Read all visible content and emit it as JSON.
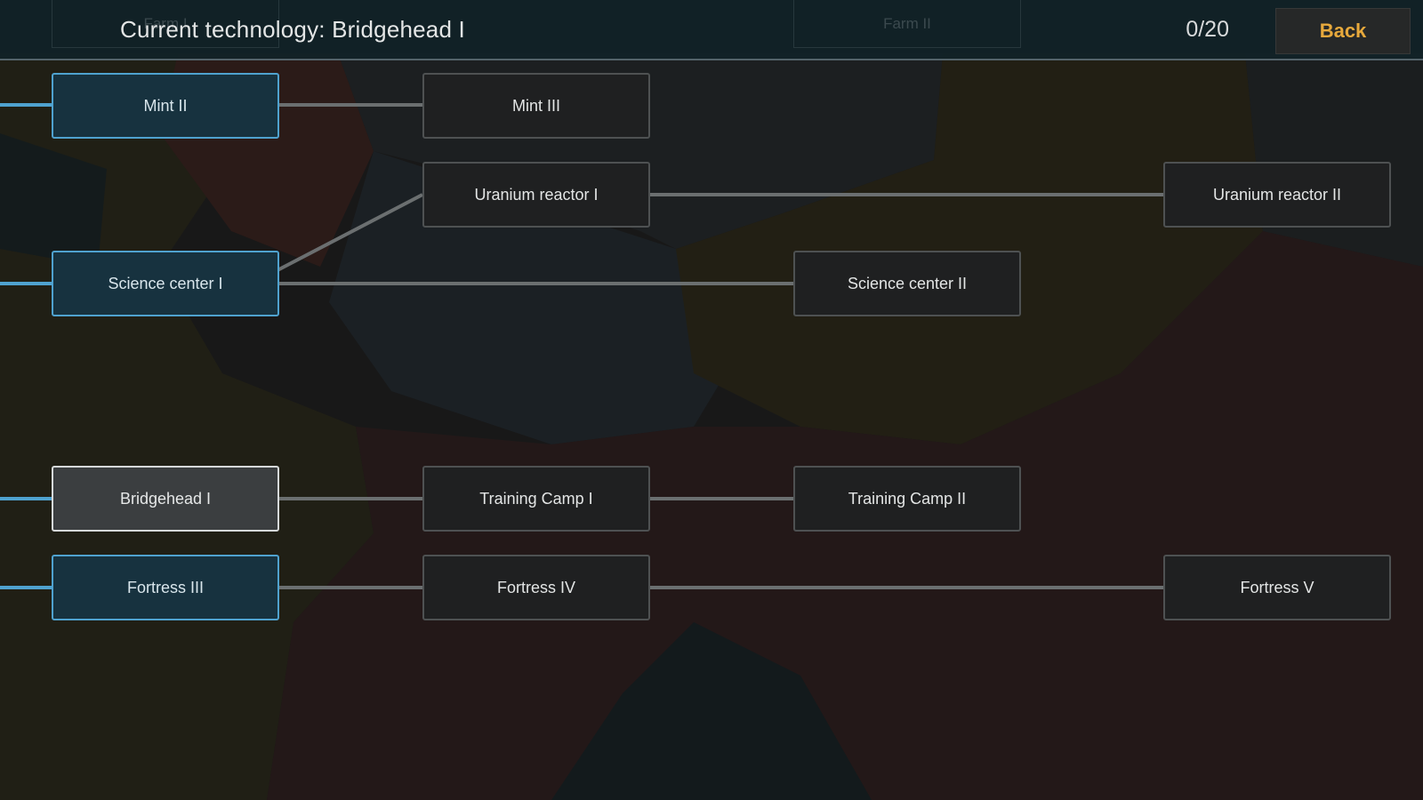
{
  "header": {
    "title": "Current technology: Bridgehead I",
    "counter": "0/20",
    "back_label": "Back"
  },
  "ghost_nodes": [
    {
      "label": "Farm I"
    },
    {
      "label": "Farm II"
    }
  ],
  "nodes": {
    "mint_2": {
      "label": "Mint II",
      "state": "researched"
    },
    "mint_3": {
      "label": "Mint III",
      "state": "locked"
    },
    "uranium_1": {
      "label": "Uranium reactor I",
      "state": "locked"
    },
    "uranium_2": {
      "label": "Uranium reactor II",
      "state": "locked"
    },
    "science_1": {
      "label": "Science center I",
      "state": "researched"
    },
    "science_2": {
      "label": "Science center II",
      "state": "locked"
    },
    "bridgehead_1": {
      "label": "Bridgehead I",
      "state": "current"
    },
    "training_1": {
      "label": "Training Camp I",
      "state": "locked"
    },
    "training_2": {
      "label": "Training Camp II",
      "state": "locked"
    },
    "fortress_3": {
      "label": "Fortress III",
      "state": "researched"
    },
    "fortress_4": {
      "label": "Fortress IV",
      "state": "locked"
    },
    "fortress_5": {
      "label": "Fortress V",
      "state": "locked"
    }
  },
  "colors": {
    "accent_researched": "#4fa2cf",
    "back_text": "#e7a93c",
    "current_border": "#d6d9da"
  }
}
